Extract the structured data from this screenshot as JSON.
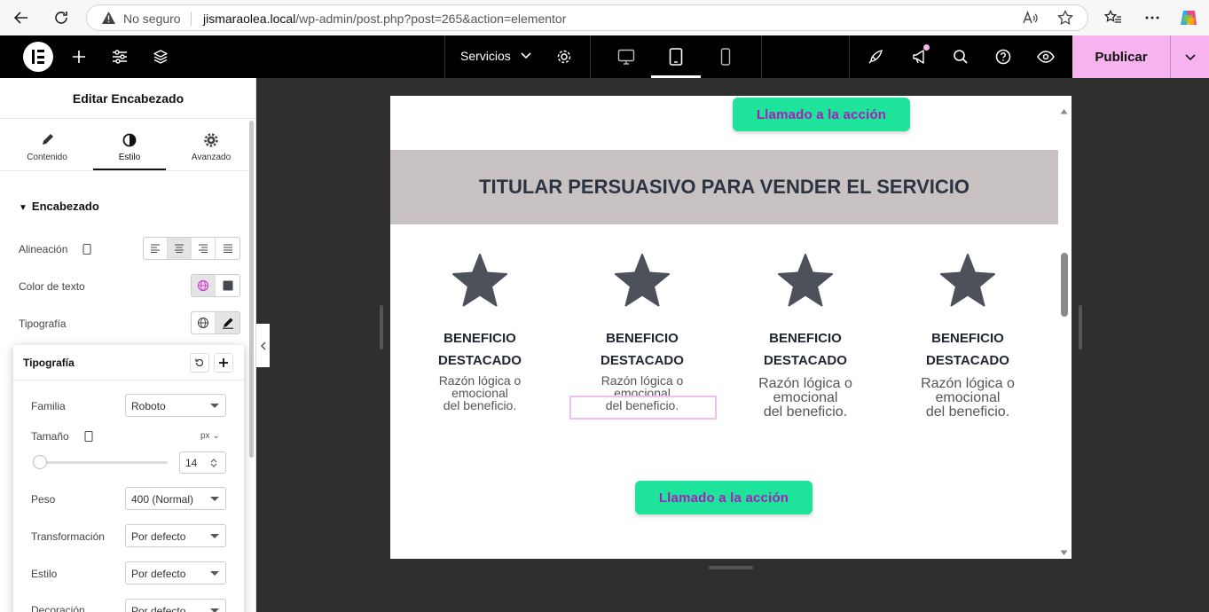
{
  "browser": {
    "security_label": "No seguro",
    "url_host": "jismaraolea.local",
    "url_path": "/wp-admin/post.php?post=265&action=elementor"
  },
  "topbar": {
    "page_name": "Servicios",
    "publish_label": "Publicar"
  },
  "panel": {
    "title": "Editar Encabezado",
    "tabs": [
      {
        "label": "Contenido"
      },
      {
        "label": "Estilo"
      },
      {
        "label": "Avanzado"
      }
    ],
    "section_title": "Encabezado",
    "controls": {
      "alignment_label": "Alineación",
      "text_color_label": "Color de texto",
      "typography_label": "Tipografía"
    }
  },
  "typography": {
    "title": "Tipografía",
    "family_label": "Familia",
    "family_value": "Roboto",
    "size_label": "Tamaño",
    "size_unit": "px",
    "size_value": "14",
    "weight_label": "Peso",
    "weight_value": "400 (Normal)",
    "transform_label": "Transformación",
    "transform_value": "Por defecto",
    "style_label": "Estilo",
    "style_value": "Por defecto",
    "decoration_label": "Decoración",
    "decoration_value": "Por defecto"
  },
  "canvas": {
    "cta_top": "Llamado a la acción",
    "headline": "TITULAR PERSUASIVO PARA VENDER EL SERVICIO",
    "features": [
      {
        "title_line1": "BENEFICIO",
        "title_line2": "DESTACADO",
        "desc1": "Razón lógica o",
        "desc2": "emocional",
        "desc3": "del beneficio."
      },
      {
        "title_line1": "BENEFICIO",
        "title_line2": "DESTACADO",
        "desc1": "Razón lógica o",
        "desc2": "emocional",
        "desc3": "del beneficio."
      },
      {
        "title_line1": "BENEFICIO",
        "title_line2": "DESTACADO",
        "desc1": "Razón lógica o",
        "desc2": "emocional",
        "desc3": "del beneficio."
      },
      {
        "title_line1": "BENEFICIO",
        "title_line2": "DESTACADO",
        "desc1": "Razón lógica o",
        "desc2": "emocional",
        "desc3": "del beneficio."
      }
    ],
    "cta_bottom": "Llamado a la acción"
  },
  "colors": {
    "accent_pink": "#f7b3f0",
    "cta_green": "#1ee39b",
    "cta_text": "#a321b8",
    "hero_band": "#c9c2c2"
  }
}
